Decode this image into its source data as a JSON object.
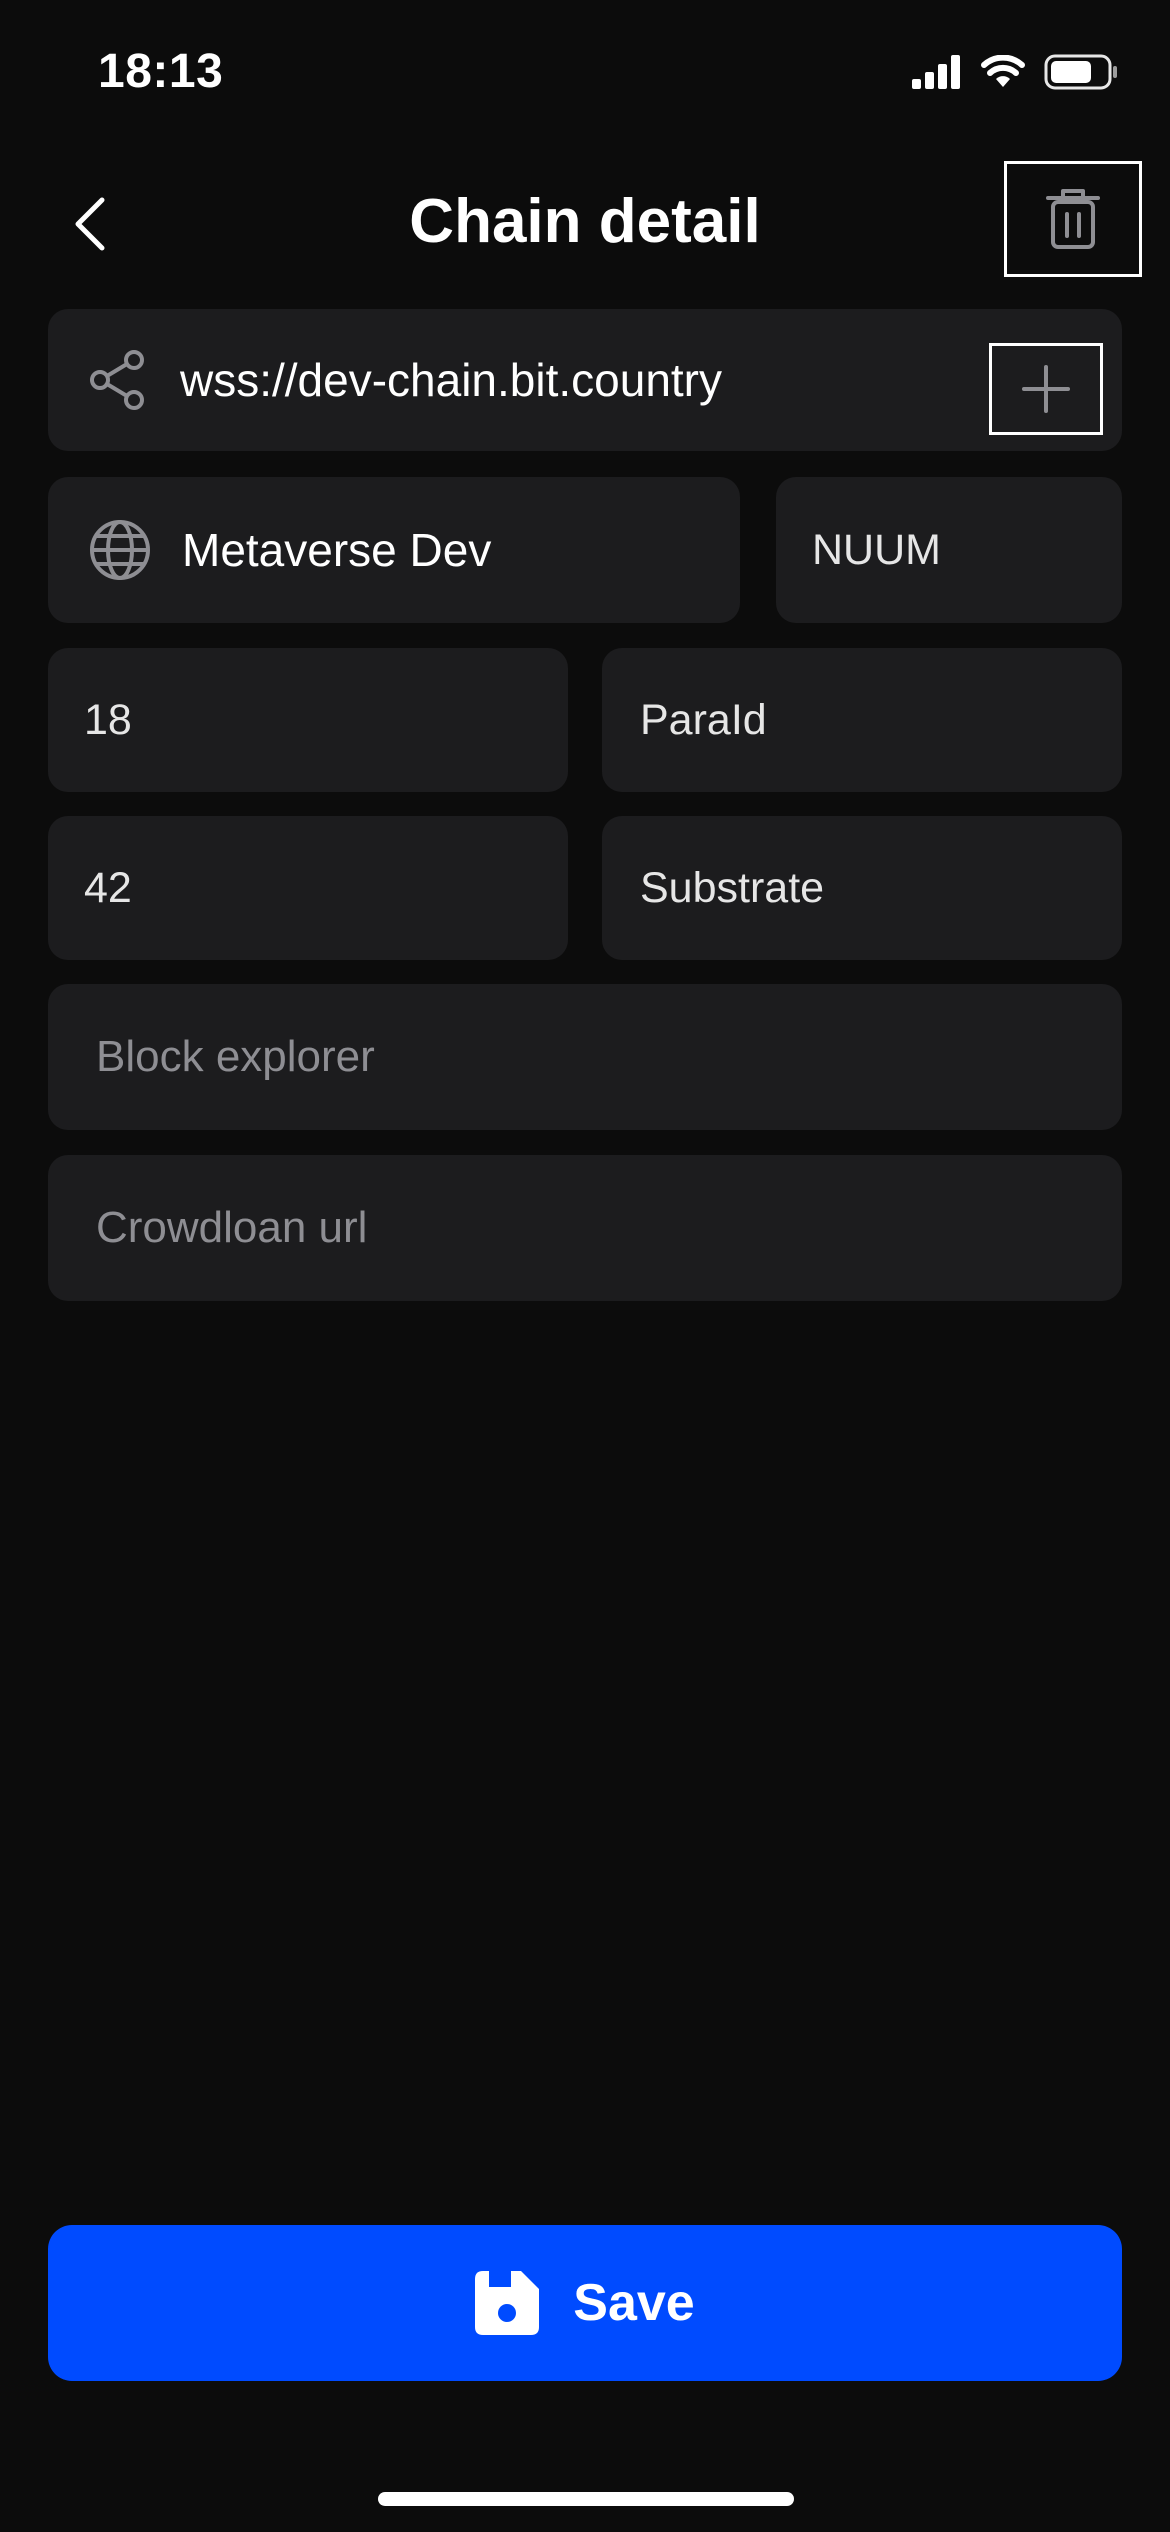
{
  "status_bar": {
    "time": "18:13"
  },
  "header": {
    "title": "Chain detail"
  },
  "form": {
    "provider_url": "wss://dev-chain.bit.country",
    "chain_name": "Metaverse Dev",
    "symbol": "NUUM",
    "decimals": "18",
    "para_id_placeholder": "ParaId",
    "ss58_prefix": "42",
    "chain_type": "Substrate",
    "block_explorer_placeholder": "Block explorer",
    "crowdloan_url_placeholder": "Crowdloan url"
  },
  "actions": {
    "save_label": "Save"
  },
  "icons": {
    "back": "chevron-left-icon",
    "delete": "trash-icon",
    "provider": "share-icon",
    "add": "plus-icon",
    "chain": "globe-icon",
    "save": "floppy-disk-icon"
  },
  "colors": {
    "background": "#0c0c0c",
    "field": "#1c1c1e",
    "accent": "#004bff",
    "placeholder": "#8e8e93"
  }
}
